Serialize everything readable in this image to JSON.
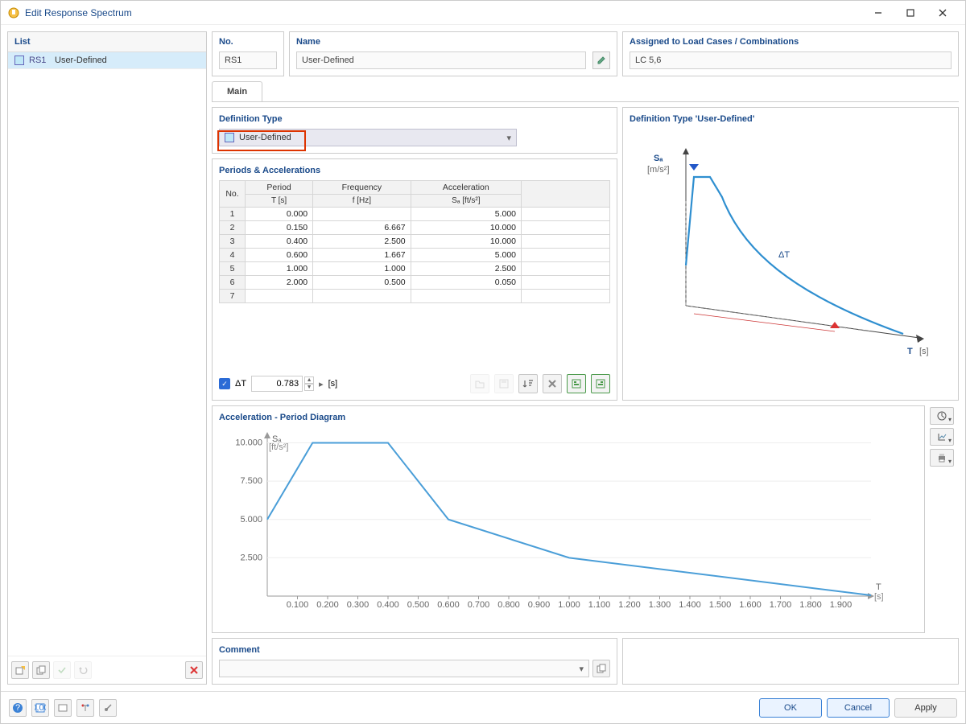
{
  "window": {
    "title": "Edit Response Spectrum"
  },
  "list": {
    "title": "List",
    "items": [
      {
        "id": "RS1",
        "name": "User-Defined"
      }
    ]
  },
  "fields": {
    "no": {
      "label": "No.",
      "value": "RS1"
    },
    "name": {
      "label": "Name",
      "value": "User-Defined"
    },
    "assigned": {
      "label": "Assigned to Load Cases / Combinations",
      "value": "LC 5,6"
    }
  },
  "tabs": {
    "main": "Main"
  },
  "definition": {
    "title": "Definition Type",
    "value": "User-Defined",
    "preview_title": "Definition Type 'User-Defined'"
  },
  "table": {
    "title": "Periods & Accelerations",
    "headers": {
      "no": "No.",
      "period": "Period",
      "period_sub": "T [s]",
      "freq": "Frequency",
      "freq_sub": "f [Hz]",
      "acc": "Acceleration",
      "acc_sub": "Sₐ [ft/s²]"
    },
    "rows": [
      {
        "n": "1",
        "period": "0.000",
        "freq": "",
        "acc": "5.000"
      },
      {
        "n": "2",
        "period": "0.150",
        "freq": "6.667",
        "acc": "10.000"
      },
      {
        "n": "3",
        "period": "0.400",
        "freq": "2.500",
        "acc": "10.000"
      },
      {
        "n": "4",
        "period": "0.600",
        "freq": "1.667",
        "acc": "5.000"
      },
      {
        "n": "5",
        "period": "1.000",
        "freq": "1.000",
        "acc": "2.500"
      },
      {
        "n": "6",
        "period": "2.000",
        "freq": "0.500",
        "acc": "0.050"
      },
      {
        "n": "7",
        "period": "",
        "freq": "",
        "acc": ""
      }
    ]
  },
  "dt": {
    "label": "ΔT",
    "value": "0.783",
    "unit": "[s]"
  },
  "preview_chart": {
    "y_label": "Sₐ",
    "y_unit": "[m/s²]",
    "x_label": "T",
    "x_unit": "[s]",
    "dT_label": "ΔT"
  },
  "chart": {
    "title": "Acceleration - Period Diagram",
    "y_label": "Sₐ",
    "y_unit": "[ft/s²]",
    "x_label": "T",
    "x_unit": "[s]"
  },
  "chart_data": {
    "type": "line",
    "title": "Acceleration - Period Diagram",
    "xlabel": "T [s]",
    "ylabel": "Sₐ [ft/s²]",
    "x": [
      0.0,
      0.15,
      0.4,
      0.6,
      1.0,
      2.0
    ],
    "values": [
      5.0,
      10.0,
      10.0,
      5.0,
      2.5,
      0.05
    ],
    "x_ticks": [
      0.1,
      0.2,
      0.3,
      0.4,
      0.5,
      0.6,
      0.7,
      0.8,
      0.9,
      1.0,
      1.1,
      1.2,
      1.3,
      1.4,
      1.5,
      1.6,
      1.7,
      1.8,
      1.9
    ],
    "y_ticks": [
      2.5,
      5.0,
      7.5,
      10.0
    ],
    "xlim": [
      0.0,
      2.0
    ],
    "ylim": [
      0.0,
      10.5
    ]
  },
  "comment": {
    "title": "Comment",
    "value": ""
  },
  "buttons": {
    "ok": "OK",
    "cancel": "Cancel",
    "apply": "Apply"
  }
}
